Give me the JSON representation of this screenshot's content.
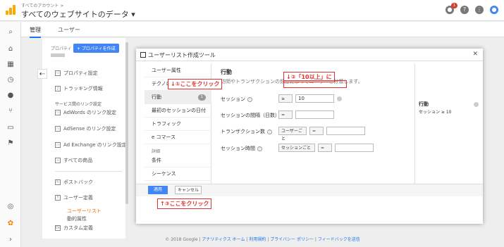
{
  "header": {
    "breadcrumb": "すべてのアカウント >",
    "title": "すべてのウェブサイトのデータ ▾",
    "notification_count": "1"
  },
  "admin": {
    "tabs": [
      {
        "label": "管理"
      },
      {
        "label": "ユーザー"
      }
    ],
    "property_label": "プロパティ",
    "create_property": "+ プロパティを作成",
    "items": [
      {
        "label": "プロパティ設定"
      },
      {
        "label": "トラッキング情報"
      },
      {
        "label": "サービス間のリンク設定"
      },
      {
        "label": "AdWords のリンク設定"
      },
      {
        "label": "AdSense のリンク設定"
      },
      {
        "label": "Ad Exchange のリンク設定"
      },
      {
        "label": "すべての商品"
      },
      {
        "label": "ポストバック"
      },
      {
        "label": "ユーザー定義"
      },
      {
        "label": "ユーザーリスト"
      },
      {
        "label": "動的属性"
      },
      {
        "label": "カスタム定義"
      }
    ]
  },
  "modal": {
    "title": "ユーザーリスト作成ツール",
    "sidebar": [
      {
        "label": "ユーザー属性"
      },
      {
        "label": "テクノロジー"
      },
      {
        "label": "行動",
        "count": "1"
      },
      {
        "label": "最初のセッションの日付"
      },
      {
        "label": "トラフィック"
      },
      {
        "label": "e コマース"
      },
      {
        "label": "詳細"
      },
      {
        "label": "条件"
      },
      {
        "label": "シーケンス"
      }
    ],
    "section_title": "行動",
    "section_desc": "訪問やトランザクションの頻度によってユーザーを分類します。",
    "rows": [
      {
        "label": "セッション",
        "op": "≥",
        "value": "10"
      },
      {
        "label": "セッションの間隔（日数）",
        "op": "="
      },
      {
        "label": "トランザクション数",
        "scope": "ユーザーごと",
        "op": "="
      },
      {
        "label": "セッション時間",
        "scope": "セッションごと",
        "op": "="
      }
    ],
    "summary_title": "行動",
    "summary_value": "セッション ≥ 10",
    "apply": "適用",
    "cancel": "キャンセル"
  },
  "annotations": {
    "a1": "↓①ここをクリック",
    "a2": "↓②「10以上」に",
    "a3": "↑③ここをクリック"
  },
  "footer": {
    "copyright": "© 2018 Google |",
    "home": "アナリティクス ホーム",
    "terms": "利用規約",
    "privacy": "プライバシー ポリシー",
    "feedback": "フィードバックを送信"
  }
}
